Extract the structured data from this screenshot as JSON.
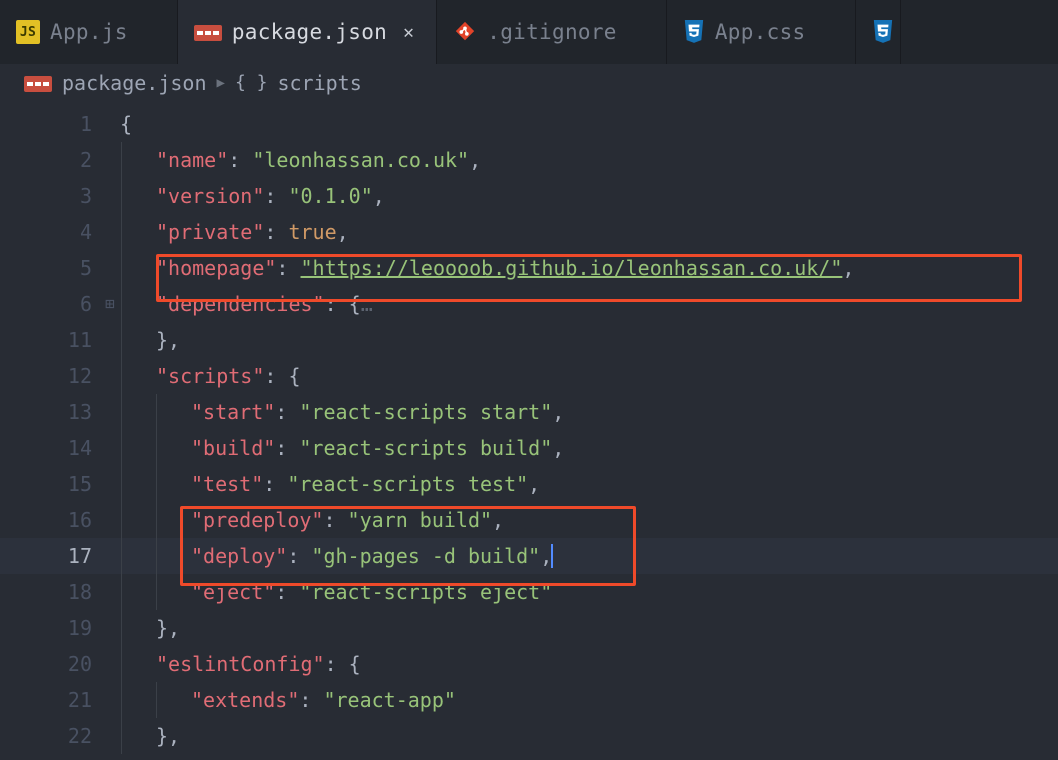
{
  "tabs": [
    {
      "label": "App.js",
      "icon": "js",
      "active": false
    },
    {
      "label": "package.json",
      "icon": "json",
      "active": true
    },
    {
      "label": ".gitignore",
      "icon": "git",
      "active": false
    },
    {
      "label": "App.css",
      "icon": "css",
      "active": false
    }
  ],
  "breadcrumb": {
    "file_icon": "json",
    "file": "package.json",
    "segment_icon": "braces",
    "segment": "scripts"
  },
  "code": {
    "lines": [
      {
        "n": 1,
        "indent": 0,
        "tokens": [
          [
            "punc",
            "{"
          ]
        ]
      },
      {
        "n": 2,
        "indent": 1,
        "tokens": [
          [
            "key",
            "\"name\""
          ],
          [
            "punc",
            ": "
          ],
          [
            "str",
            "\"leonhassan.co.uk\""
          ],
          [
            "punc",
            ","
          ]
        ]
      },
      {
        "n": 3,
        "indent": 1,
        "tokens": [
          [
            "key",
            "\"version\""
          ],
          [
            "punc",
            ": "
          ],
          [
            "str",
            "\"0.1.0\""
          ],
          [
            "punc",
            ","
          ]
        ]
      },
      {
        "n": 4,
        "indent": 1,
        "tokens": [
          [
            "key",
            "\"private\""
          ],
          [
            "punc",
            ": "
          ],
          [
            "bool",
            "true"
          ],
          [
            "punc",
            ","
          ]
        ]
      },
      {
        "n": 5,
        "indent": 1,
        "tokens": [
          [
            "key",
            "\"homepage\""
          ],
          [
            "punc",
            ": "
          ],
          [
            "url",
            "\"https://leoooob.github.io/leonhassan.co.uk/\""
          ],
          [
            "punc",
            ","
          ]
        ]
      },
      {
        "n": 6,
        "indent": 1,
        "fold": true,
        "tokens": [
          [
            "key",
            "\"dependencies\""
          ],
          [
            "punc",
            ": {"
          ],
          [
            "dim",
            "…"
          ]
        ]
      },
      {
        "n": 11,
        "indent": 1,
        "tokens": [
          [
            "punc",
            "},"
          ]
        ]
      },
      {
        "n": 12,
        "indent": 1,
        "tokens": [
          [
            "key",
            "\"scripts\""
          ],
          [
            "punc",
            ": {"
          ]
        ]
      },
      {
        "n": 13,
        "indent": 2,
        "tokens": [
          [
            "key",
            "\"start\""
          ],
          [
            "punc",
            ": "
          ],
          [
            "str",
            "\"react-scripts start\""
          ],
          [
            "punc",
            ","
          ]
        ]
      },
      {
        "n": 14,
        "indent": 2,
        "tokens": [
          [
            "key",
            "\"build\""
          ],
          [
            "punc",
            ": "
          ],
          [
            "str",
            "\"react-scripts build\""
          ],
          [
            "punc",
            ","
          ]
        ]
      },
      {
        "n": 15,
        "indent": 2,
        "tokens": [
          [
            "key",
            "\"test\""
          ],
          [
            "punc",
            ": "
          ],
          [
            "str",
            "\"react-scripts test\""
          ],
          [
            "punc",
            ","
          ]
        ]
      },
      {
        "n": 16,
        "indent": 2,
        "tokens": [
          [
            "key",
            "\"predeploy\""
          ],
          [
            "punc",
            ": "
          ],
          [
            "str",
            "\"yarn build\""
          ],
          [
            "punc",
            ","
          ]
        ]
      },
      {
        "n": 17,
        "indent": 2,
        "current": true,
        "tokens": [
          [
            "key",
            "\"deploy\""
          ],
          [
            "punc",
            ": "
          ],
          [
            "str",
            "\"gh-pages -d build\""
          ],
          [
            "punc",
            ","
          ]
        ],
        "cursor": true
      },
      {
        "n": 18,
        "indent": 2,
        "tokens": [
          [
            "key",
            "\"eject\""
          ],
          [
            "punc",
            ": "
          ],
          [
            "str",
            "\"react-scripts eject\""
          ]
        ]
      },
      {
        "n": 19,
        "indent": 1,
        "tokens": [
          [
            "punc",
            "},"
          ]
        ]
      },
      {
        "n": 20,
        "indent": 1,
        "tokens": [
          [
            "key",
            "\"eslintConfig\""
          ],
          [
            "punc",
            ": {"
          ]
        ]
      },
      {
        "n": 21,
        "indent": 2,
        "tokens": [
          [
            "key",
            "\"extends\""
          ],
          [
            "punc",
            ": "
          ],
          [
            "str",
            "\"react-app\""
          ]
        ]
      },
      {
        "n": 22,
        "indent": 1,
        "tokens": [
          [
            "punc",
            "},"
          ]
        ]
      }
    ]
  },
  "icons": {
    "js_text": "JS"
  },
  "highlights": [
    {
      "id": "homepage-highlight"
    },
    {
      "id": "scripts-highlight"
    }
  ]
}
